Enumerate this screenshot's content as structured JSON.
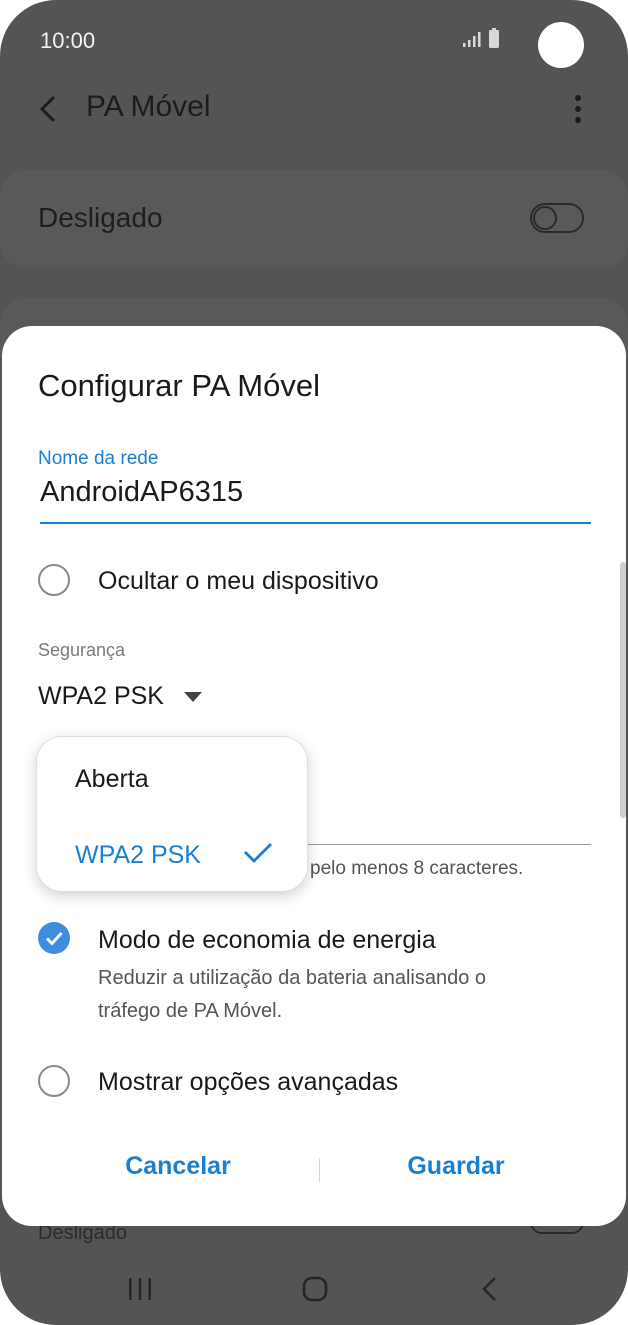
{
  "status_bar": {
    "time": "10:00"
  },
  "app_bar": {
    "title": "PA Móvel"
  },
  "background": {
    "hotspot_toggle_label": "Desligado",
    "bottom_label": "Desligado"
  },
  "dialog": {
    "title": "Configurar PA Móvel",
    "network_name": {
      "label": "Nome da rede",
      "value": "AndroidAP6315"
    },
    "hide_device": {
      "label": "Ocultar o meu dispositivo",
      "checked": false
    },
    "security": {
      "label": "Segurança",
      "value": "WPA2 PSK",
      "options": [
        {
          "label": "Aberta",
          "selected": false
        },
        {
          "label": "WPA2 PSK",
          "selected": true
        }
      ]
    },
    "password_hint": "pelo menos 8 caracteres.",
    "power_saving": {
      "label": "Modo de economia de energia",
      "description_line1": "Reduzir a utilização da bateria analisando o",
      "description_line2": "tráfego de PA Móvel.",
      "checked": true
    },
    "advanced": {
      "label": "Mostrar opções avançadas",
      "checked": false
    },
    "buttons": {
      "cancel": "Cancelar",
      "save": "Guardar"
    }
  },
  "colors": {
    "accent": "#1a7fcf",
    "checkbox": "#3e8ede",
    "scrim": "#545454"
  },
  "icons": [
    "signal-icon",
    "battery-icon",
    "back-arrow-icon",
    "more-options-icon",
    "chevron-down-icon",
    "checkmark-icon",
    "recent-apps-icon",
    "home-icon",
    "nav-back-icon"
  ]
}
